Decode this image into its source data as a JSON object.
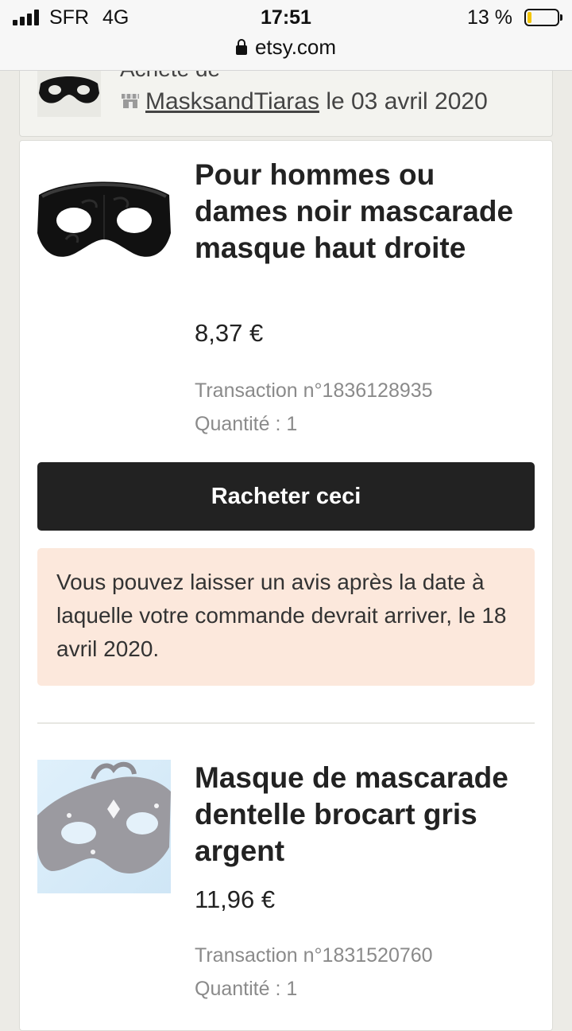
{
  "status_bar": {
    "carrier": "SFR",
    "network": "4G",
    "time": "17:51",
    "battery": "13 %",
    "battery_level": 0.13,
    "battery_color": "#f3c500"
  },
  "url_bar": {
    "domain": "etsy.com",
    "icon": "lock-icon"
  },
  "shop": {
    "purchased_label": "Acheté de",
    "store_icon": "store-icon",
    "seller_name": "MasksandTiaras",
    "date_text": "le 03 avril 2020"
  },
  "items": [
    {
      "title": "Pour hommes ou dames noir mascarade masque haut droite",
      "price": "8,37 €",
      "transaction": "Transaction n°1836128935",
      "quantity": "Quantité : 1"
    },
    {
      "title": "Masque de mascarade dentelle brocart gris argent",
      "price": "11,96 €",
      "transaction": "Transaction n°1831520760",
      "quantity": "Quantité : 1"
    }
  ],
  "actions": {
    "rebuy_label": "Racheter ceci"
  },
  "review_notice": {
    "text": "Vous pouvez laisser un avis après la date à laquelle votre commande devrait arriver, le 18 avril 2020."
  },
  "colors": {
    "primary_button": "#222222",
    "notice_background": "#fce8dc",
    "page_background": "#ecebe6"
  }
}
